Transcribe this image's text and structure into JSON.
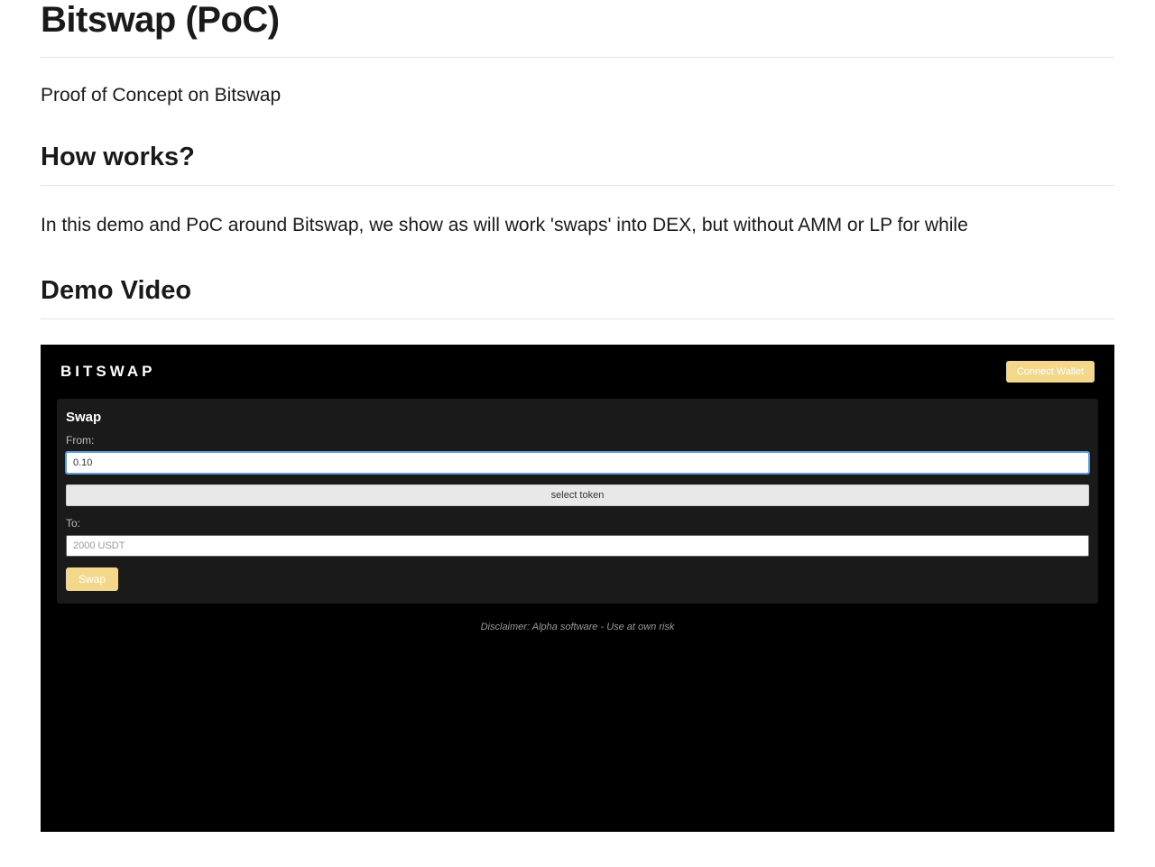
{
  "page": {
    "title": "Bitswap (PoC)",
    "subtitle": "Proof of Concept on Bitswap",
    "how_works_heading": "How works?",
    "how_works_body": "In this demo and PoC around Bitswap, we show as will work 'swaps' into DEX, but without AMM or LP for while",
    "demo_video_heading": "Demo Video"
  },
  "demo": {
    "logo": "BITSWAP",
    "connect_wallet": "Connect Wallet",
    "swap_title": "Swap",
    "from_label": "From:",
    "from_value": "0.10",
    "select_token": "select token",
    "to_label": "To:",
    "to_placeholder": "2000 USDT",
    "swap_button": "Swap",
    "disclaimer": "Disclaimer: Alpha software - Use at own risk"
  }
}
